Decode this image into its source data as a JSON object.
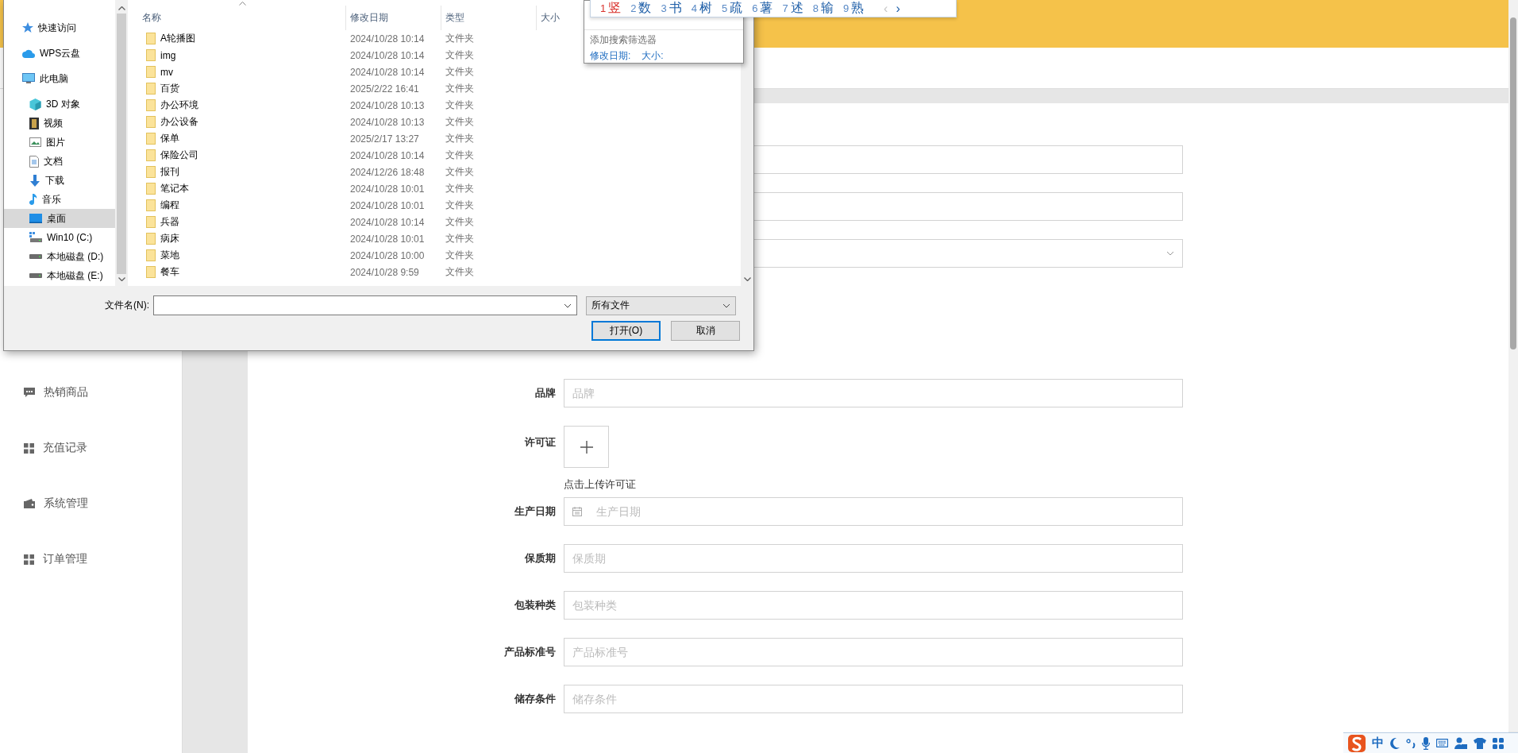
{
  "page": {
    "sidebar": {
      "items": [
        {
          "kind": "chat",
          "label": "热销商品"
        },
        {
          "kind": "grid",
          "label": "充值记录"
        },
        {
          "kind": "wallet",
          "label": "系统管理"
        },
        {
          "kind": "grid",
          "label": "订单管理"
        }
      ]
    },
    "form": {
      "rows": [
        {
          "kind": "input"
        },
        {
          "kind": "input"
        },
        {
          "kind": "select"
        },
        {
          "kind": "input",
          "label": "品牌",
          "placeholder": "品牌"
        },
        {
          "kind": "upload",
          "label": "许可证",
          "caption": "点击上传许可证"
        },
        {
          "kind": "date",
          "label": "生产日期",
          "placeholder": "生产日期"
        },
        {
          "kind": "input",
          "label": "保质期",
          "placeholder": "保质期"
        },
        {
          "kind": "input",
          "label": "包装种类",
          "placeholder": "包装种类"
        },
        {
          "kind": "input",
          "label": "产品标准号",
          "placeholder": "产品标准号"
        },
        {
          "kind": "input",
          "label": "储存条件",
          "placeholder": "储存条件"
        }
      ]
    }
  },
  "file_dialog": {
    "nav": [
      {
        "kind": "star",
        "label": "快速访问",
        "selected": false
      },
      {
        "kind": "cloud",
        "label": "WPS云盘",
        "selected": false
      },
      {
        "kind": "monitor",
        "label": "此电脑",
        "selected": false,
        "children": [
          {
            "kind": "cube",
            "label": "3D 对象",
            "selected": false
          },
          {
            "kind": "film",
            "label": "视频",
            "selected": false
          },
          {
            "kind": "image",
            "label": "图片",
            "selected": false
          },
          {
            "kind": "document",
            "label": "文档",
            "selected": false
          },
          {
            "kind": "download",
            "label": "下载",
            "selected": false
          },
          {
            "kind": "music",
            "label": "音乐",
            "selected": false
          },
          {
            "kind": "desktop",
            "label": "桌面",
            "selected": true
          },
          {
            "kind": "windrive",
            "label": "Win10 (C:)",
            "selected": false
          },
          {
            "kind": "drive",
            "label": "本地磁盘 (D:)",
            "selected": false
          },
          {
            "kind": "drive",
            "label": "本地磁盘 (E:)",
            "selected": false
          }
        ]
      }
    ],
    "columns": [
      "名称",
      "修改日期",
      "类型",
      "大小"
    ],
    "files": [
      {
        "name": "A轮播图",
        "modified": "2024/10/28 10:14",
        "type": "文件夹"
      },
      {
        "name": "img",
        "modified": "2024/10/28 10:14",
        "type": "文件夹"
      },
      {
        "name": "mv",
        "modified": "2024/10/28 10:14",
        "type": "文件夹"
      },
      {
        "name": "百货",
        "modified": "2025/2/22 16:41",
        "type": "文件夹"
      },
      {
        "name": "办公环境",
        "modified": "2024/10/28 10:13",
        "type": "文件夹"
      },
      {
        "name": "办公设备",
        "modified": "2024/10/28 10:13",
        "type": "文件夹"
      },
      {
        "name": "保单",
        "modified": "2025/2/17 13:27",
        "type": "文件夹"
      },
      {
        "name": "保险公司",
        "modified": "2024/10/28 10:14",
        "type": "文件夹"
      },
      {
        "name": "报刊",
        "modified": "2024/12/26 18:48",
        "type": "文件夹"
      },
      {
        "name": "笔记本",
        "modified": "2024/10/28 10:01",
        "type": "文件夹"
      },
      {
        "name": "编程",
        "modified": "2024/10/28 10:01",
        "type": "文件夹"
      },
      {
        "name": "兵器",
        "modified": "2024/10/28 10:14",
        "type": "文件夹"
      },
      {
        "name": "病床",
        "modified": "2024/10/28 10:01",
        "type": "文件夹"
      },
      {
        "name": "菜地",
        "modified": "2024/10/28 10:00",
        "type": "文件夹"
      },
      {
        "name": "餐车",
        "modified": "2024/10/28 9:59",
        "type": "文件夹"
      }
    ],
    "filename_label": "文件名(N):",
    "filetype": "所有文件",
    "buttons": [
      {
        "label": "打开(O)",
        "default": true
      },
      {
        "label": "取消",
        "default": false
      }
    ]
  },
  "search_popup": {
    "filter_hint": "添加搜索筛选器",
    "filters": [
      "修改日期:",
      "大小:"
    ]
  },
  "ime_candidates": {
    "candidates": [
      {
        "index": "1",
        "text": "竖",
        "selected": true
      },
      {
        "index": "2",
        "text": "数",
        "selected": false
      },
      {
        "index": "3",
        "text": "书",
        "selected": false
      },
      {
        "index": "4",
        "text": "树",
        "selected": false
      },
      {
        "index": "5",
        "text": "疏",
        "selected": false
      },
      {
        "index": "6",
        "text": "薯",
        "selected": false
      },
      {
        "index": "7",
        "text": "述",
        "selected": false
      },
      {
        "index": "8",
        "text": "输",
        "selected": false
      },
      {
        "index": "9",
        "text": "熟",
        "selected": false
      }
    ],
    "prev": {
      "text": "‹",
      "disabled": true
    },
    "next": {
      "text": "›",
      "disabled": false
    }
  },
  "ime_toolbar": {
    "mode": "中"
  }
}
